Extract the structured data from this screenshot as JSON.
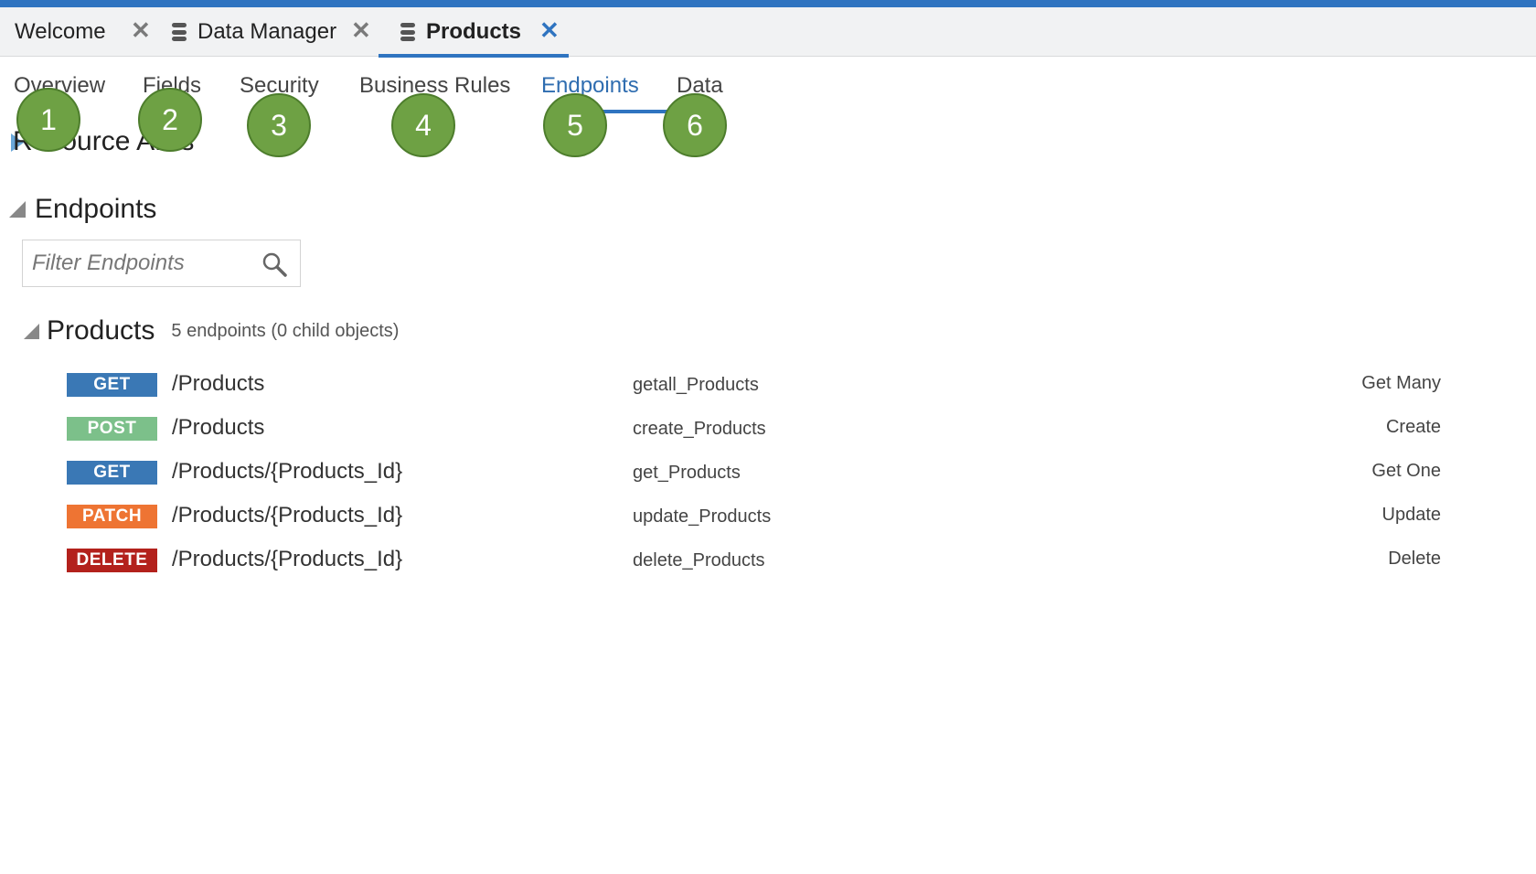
{
  "doc_tabs": [
    {
      "label": "Welcome",
      "close": "✕"
    },
    {
      "label": "Data Manager",
      "close": "✕"
    },
    {
      "label": "Products",
      "close": "✕"
    }
  ],
  "subtabs": [
    "Overview",
    "Fields",
    "Security",
    "Business Rules",
    "Endpoints",
    "Data"
  ],
  "active_subtab": "Endpoints",
  "resource_row_text": "Resource APIs",
  "callouts": [
    "1",
    "2",
    "3",
    "4",
    "5",
    "6"
  ],
  "endpoints_section": {
    "title": "Endpoints",
    "filter_placeholder": "Filter Endpoints"
  },
  "group": {
    "title": "Products",
    "count": "5 endpoints (0 child objects)"
  },
  "endpoints": [
    {
      "method": "GET",
      "path": "/Products",
      "operation": "getall_Products",
      "kind": "Get Many"
    },
    {
      "method": "POST",
      "path": "/Products",
      "operation": "create_Products",
      "kind": "Create"
    },
    {
      "method": "GET",
      "path": "/Products/{Products_Id}",
      "operation": "get_Products",
      "kind": "Get One"
    },
    {
      "method": "PATCH",
      "path": "/Products/{Products_Id}",
      "operation": "update_Products",
      "kind": "Update"
    },
    {
      "method": "DELETE",
      "path": "/Products/{Products_Id}",
      "operation": "delete_Products",
      "kind": "Delete"
    }
  ],
  "colors": {
    "accent": "#2f74c0",
    "callout": "#6ea144",
    "GET": "#3a78b5",
    "POST": "#7cc08a",
    "PATCH": "#ee7433",
    "DELETE": "#b3211c"
  }
}
